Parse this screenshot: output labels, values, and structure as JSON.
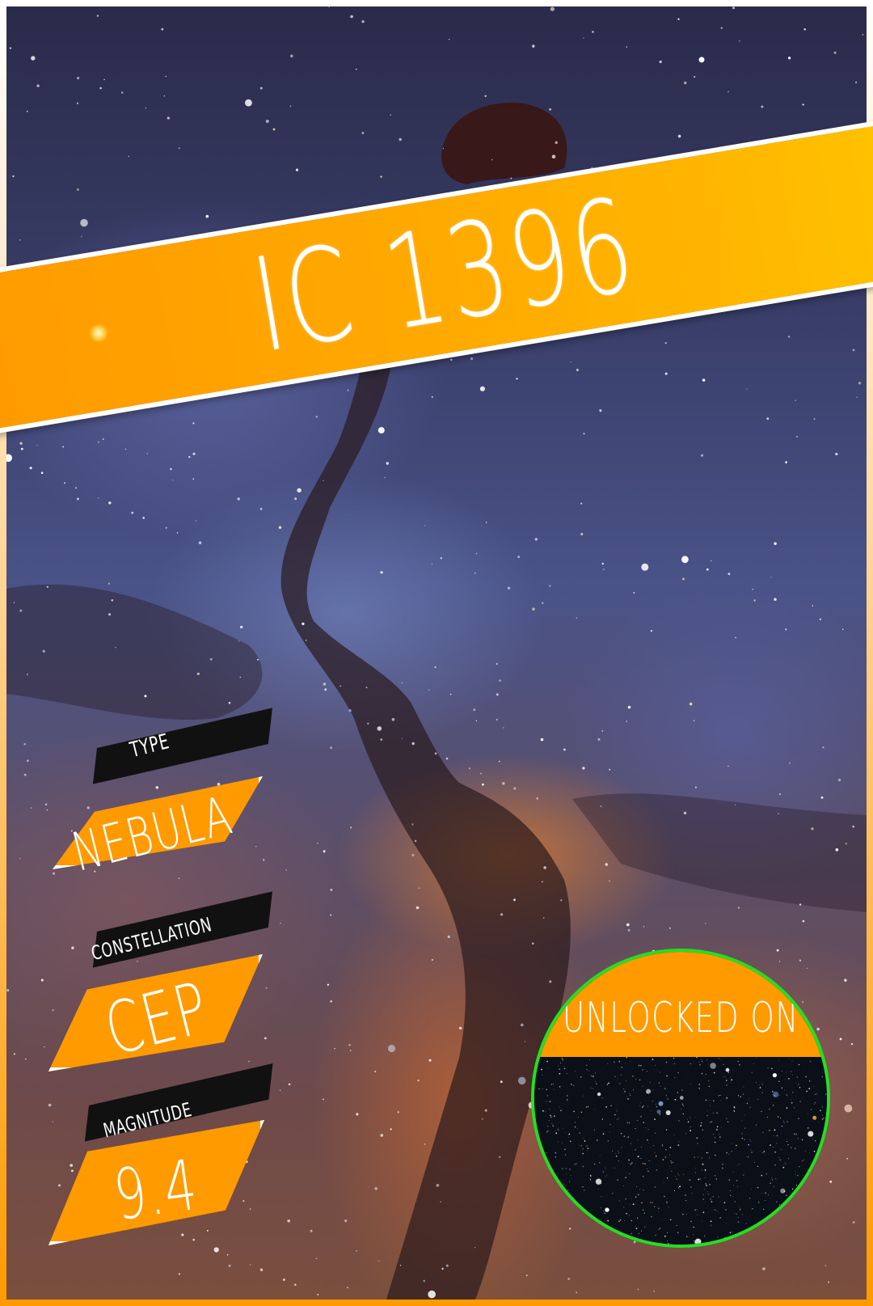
{
  "card": {
    "title": "IC 1396",
    "stats": [
      {
        "label": "TYPE",
        "value": "NEBULA"
      },
      {
        "label": "CONSTELLATION",
        "value": "CEP"
      },
      {
        "label": "MAGNITUDE",
        "value": "9.4"
      }
    ],
    "unlock": {
      "label": "UNLOCKED ON"
    }
  },
  "colors": {
    "accent": "#ff9a00",
    "badge_border": "#22e022",
    "label_band": "#111111",
    "text": "#ffffff"
  }
}
